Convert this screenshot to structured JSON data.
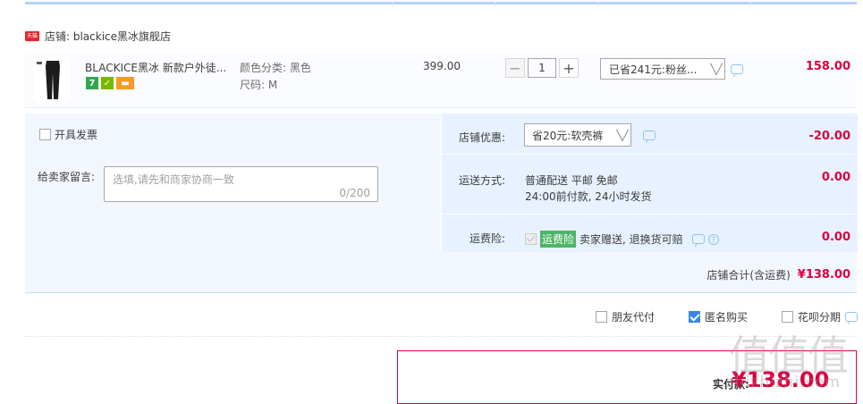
{
  "shop": {
    "name": "店铺: blackice黑冰旗舰店",
    "badge": "天猫"
  },
  "item": {
    "title": "BLACKICE黑冰 新款户外徒...",
    "badges": [
      "7"
    ],
    "sku_color": "颜色分类: 黑色",
    "sku_size": "尺码: M",
    "price": "399.00",
    "quantity": "1",
    "promo_selected": "已省241元:粉丝...",
    "total": "158.00"
  },
  "options": {
    "invoice_label": "开具发票",
    "memo_label": "给卖家留言:",
    "memo_placeholder": "选填,请先和商家协商一致",
    "memo_count": "0/200",
    "coupon_label": "店铺优惠:",
    "coupon_selected": "省20元:软壳裤",
    "coupon_amount": "-20.00",
    "shipping_label": "运送方式:",
    "shipping_line1": "普通配送 平邮 免邮",
    "shipping_line2": "24:00前付款, 24小时发货",
    "shipping_amount": "0.00",
    "insurance_label": "运费险:",
    "insurance_tag": "运费险",
    "insurance_text": "卖家赠送, 退换货可赔",
    "insurance_amount": "0.00",
    "shop_total_label": "店铺合计(含运费)",
    "shop_total_value": "¥138.00"
  },
  "checkout_options": {
    "friend_pay": "朋友代付",
    "anonymous": "匿名购买",
    "huabei": "花呗分期"
  },
  "pay": {
    "label": "实付款:",
    "value": "¥138.00"
  },
  "watermark": {
    "text": "值值值",
    "url": "zhizhizhi.com"
  },
  "colors": {
    "accent_red": "#d9003f",
    "light_blue": "#e8f1ff",
    "check_blue": "#3b84e5"
  }
}
